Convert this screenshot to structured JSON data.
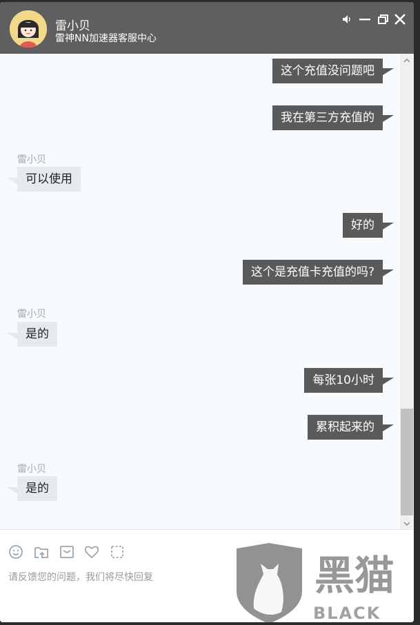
{
  "header": {
    "agent_name": "雷小贝",
    "agent_org": "雷神NN加速器客服中心",
    "controls": [
      "speaker-icon",
      "minimize-icon",
      "restore-icon",
      "close-icon"
    ]
  },
  "messages": [
    {
      "dir": "out",
      "text": "这个充值没问题吧"
    },
    {
      "dir": "out",
      "text": "我在第三方充值的"
    },
    {
      "dir": "in",
      "sender": "雷小贝",
      "text": "可以使用"
    },
    {
      "dir": "out",
      "text": "好的"
    },
    {
      "dir": "out",
      "text": "这个是充值卡充值的吗?"
    },
    {
      "dir": "in",
      "sender": "雷小贝",
      "text": "是的"
    },
    {
      "dir": "out",
      "text": "每张10小时"
    },
    {
      "dir": "out",
      "text": "累积起来的"
    },
    {
      "dir": "in",
      "sender": "雷小贝",
      "text": "是的"
    }
  ],
  "toolbar": {
    "tools": [
      "emoji-icon",
      "upload-file-icon",
      "message-icon",
      "favorite-icon",
      "screenshot-icon"
    ]
  },
  "input": {
    "placeholder": "请反馈您的问题，我们将尽快回复"
  },
  "watermark": {
    "text_cn": "黑猫",
    "text_en": "BLACK CAT"
  },
  "colors": {
    "titlebar": "#5f5f5f",
    "outgoing_bubble": "#5a5a5a",
    "incoming_bubble": "#e6eaec",
    "chat_bg": "#f7fbfe"
  }
}
